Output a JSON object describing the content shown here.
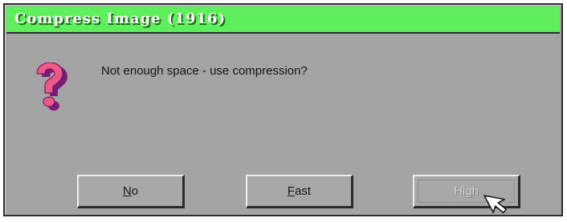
{
  "dialog": {
    "title": "Compress Image (1916)",
    "icon": "question-mark-icon",
    "message": "Not enough space - use compression?"
  },
  "buttons": {
    "no": {
      "mnemonic": "N",
      "rest": "o"
    },
    "fast": {
      "mnemonic": "F",
      "rest": "ast"
    },
    "high": {
      "label": "High"
    }
  },
  "cursor": {
    "icon": "mouse-pointer-icon"
  },
  "colors": {
    "titlebar": "#5df05a",
    "dialog_bg": "#a4a4a4",
    "icon_fill": "#f0588a",
    "icon_shadow": "#7a1d7a"
  }
}
